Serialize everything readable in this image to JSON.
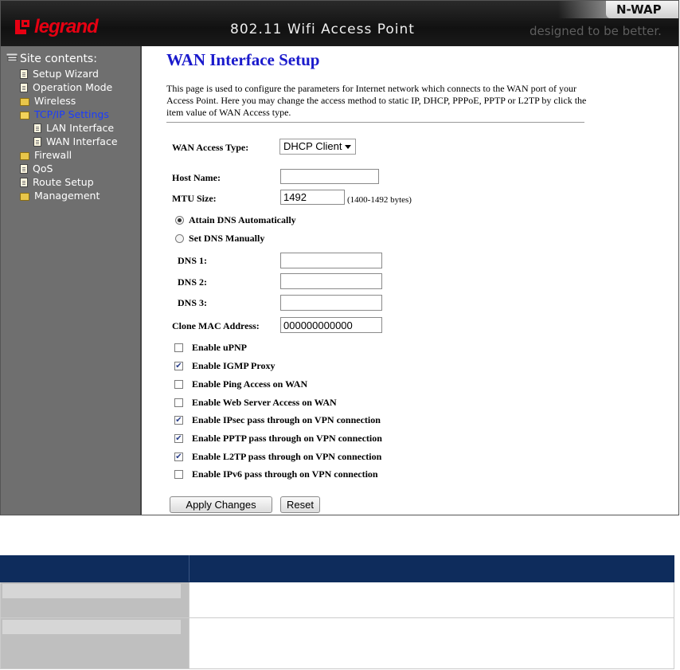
{
  "header": {
    "brand_logo": "legrand",
    "title": "802.11 Wifi Access Point",
    "product": "N-WAP",
    "tagline": "designed to be better."
  },
  "sidebar": {
    "title": "Site contents:",
    "items": [
      {
        "label": "Setup Wizard",
        "icon": "document-icon"
      },
      {
        "label": "Operation Mode",
        "icon": "document-icon"
      },
      {
        "label": "Wireless",
        "icon": "folder-icon"
      },
      {
        "label": "TCP/IP Settings",
        "icon": "folder-open-icon",
        "active": true
      },
      {
        "label": "LAN Interface",
        "icon": "document-icon"
      },
      {
        "label": "WAN Interface",
        "icon": "document-icon"
      },
      {
        "label": "Firewall",
        "icon": "folder-icon"
      },
      {
        "label": "QoS",
        "icon": "document-icon"
      },
      {
        "label": "Route Setup",
        "icon": "document-icon"
      },
      {
        "label": "Management",
        "icon": "folder-icon"
      }
    ]
  },
  "main": {
    "title": "WAN Interface Setup",
    "intro": "This page is used to configure the parameters for Internet network which connects to the WAN port of your Access Point. Here you may change the access method to static IP, DHCP, PPPoE, PPTP or L2TP by click the item value of WAN Access type.",
    "access_type_label": "WAN Access Type:",
    "access_type_value": "DHCP Client",
    "host_name_label": "Host Name:",
    "host_name_value": "",
    "mtu_label": "MTU Size:",
    "mtu_value": "1492",
    "mtu_note": "(1400-1492 bytes)",
    "dns_auto_label": "Attain DNS Automatically",
    "dns_manual_label": "Set DNS Manually",
    "dns1_label": "DNS 1:",
    "dns2_label": "DNS 2:",
    "dns3_label": "DNS 3:",
    "dns1_value": "",
    "dns2_value": "",
    "dns3_value": "",
    "clone_mac_label": "Clone MAC Address:",
    "clone_mac_value": "000000000000",
    "checks": [
      {
        "label": "Enable uPNP",
        "checked": false
      },
      {
        "label": "Enable IGMP Proxy",
        "checked": true
      },
      {
        "label": "Enable Ping Access on WAN",
        "checked": false
      },
      {
        "label": "Enable Web Server Access on WAN",
        "checked": false
      },
      {
        "label": "Enable IPsec pass through on VPN connection",
        "checked": true
      },
      {
        "label": "Enable PPTP pass through on VPN connection",
        "checked": true
      },
      {
        "label": "Enable L2TP pass through on VPN connection",
        "checked": true
      },
      {
        "label": "Enable IPv6 pass through on VPN connection",
        "checked": false
      }
    ],
    "apply_label": "Apply Changes",
    "reset_label": "Reset"
  },
  "colors": {
    "title_blue": "#1a1acc",
    "brand_red": "#e60012",
    "sidebar_gray": "#6f6f6f",
    "table_header_navy": "#0e2c5c"
  }
}
